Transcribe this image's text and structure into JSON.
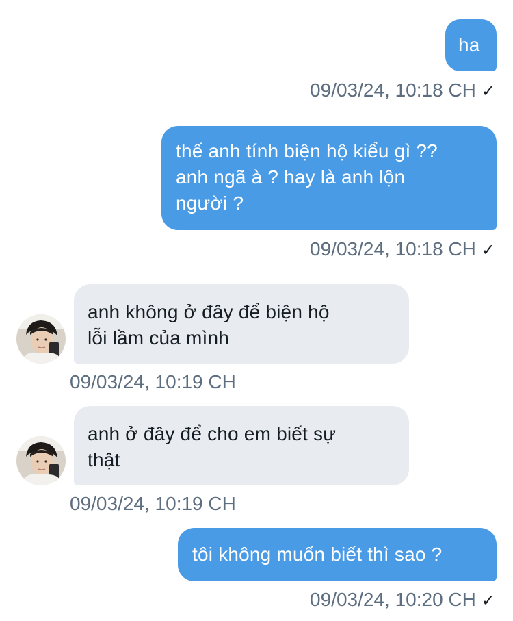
{
  "messages": [
    {
      "direction": "outgoing",
      "text": "ha",
      "timestamp": "09/03/24, 10:18 CH",
      "status": "✓"
    },
    {
      "direction": "outgoing",
      "text": "thế anh tính biện hộ kiểu gì ??\nanh ngã à ? hay là anh lộn\nngười ?",
      "timestamp": "09/03/24, 10:18 CH",
      "status": "✓"
    },
    {
      "direction": "incoming",
      "text": "anh không ở đây để biện hộ\nlỗi lầm của mình",
      "timestamp": "09/03/24, 10:19 CH",
      "avatar": "user-avatar"
    },
    {
      "direction": "incoming",
      "text": "anh ở đây để cho em biết sự\nthật",
      "timestamp": "09/03/24, 10:19 CH",
      "avatar": "user-avatar"
    },
    {
      "direction": "outgoing",
      "text": "tôi không muốn biết thì sao ?",
      "timestamp": "09/03/24, 10:20 CH",
      "status": "✓"
    }
  ],
  "colors": {
    "outgoing_bubble": "#4a9be6",
    "incoming_bubble": "#e8ebef",
    "timestamp": "#5d6e80"
  }
}
